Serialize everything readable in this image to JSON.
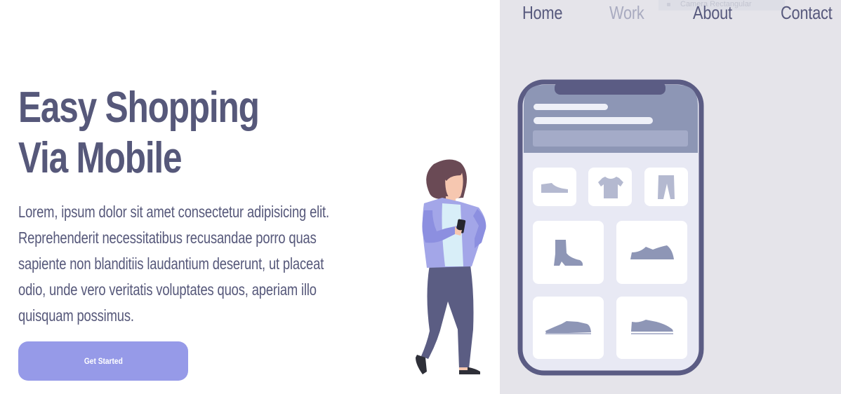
{
  "nav": {
    "items": [
      {
        "label": "Home",
        "active": false
      },
      {
        "label": "Work",
        "active": true
      },
      {
        "label": "About",
        "active": false
      },
      {
        "label": "Contact",
        "active": false
      }
    ]
  },
  "ghost_tooltip": "Camera Rectangular",
  "hero": {
    "title_line1": "Easy Shopping",
    "title_line2": "Via Mobile",
    "description": "Lorem, ipsum dolor sit amet consectetur adipisicing elit. Reprehenderit necessitatibus recusandae porro quas sapiente non blanditiis laudantium deserunt, ut placeat odio, unde vero veritatis voluptates quos, aperiam illo quisquam possimus.",
    "cta_label": "Get Started"
  },
  "colors": {
    "brand_text": "#56587a",
    "accent_button": "#969ae8",
    "panel_bg": "#e5e4ea",
    "phone_frame": "#5b5c84",
    "phone_header": "#8d96b5",
    "product_icon": "#8e96b6"
  },
  "phone": {
    "product_icons": [
      "slipper-icon",
      "tshirt-icon",
      "pants-icon",
      "boot-icon",
      "sneaker-icon",
      "flat-shoe-icon",
      "low-sneaker-icon"
    ]
  }
}
